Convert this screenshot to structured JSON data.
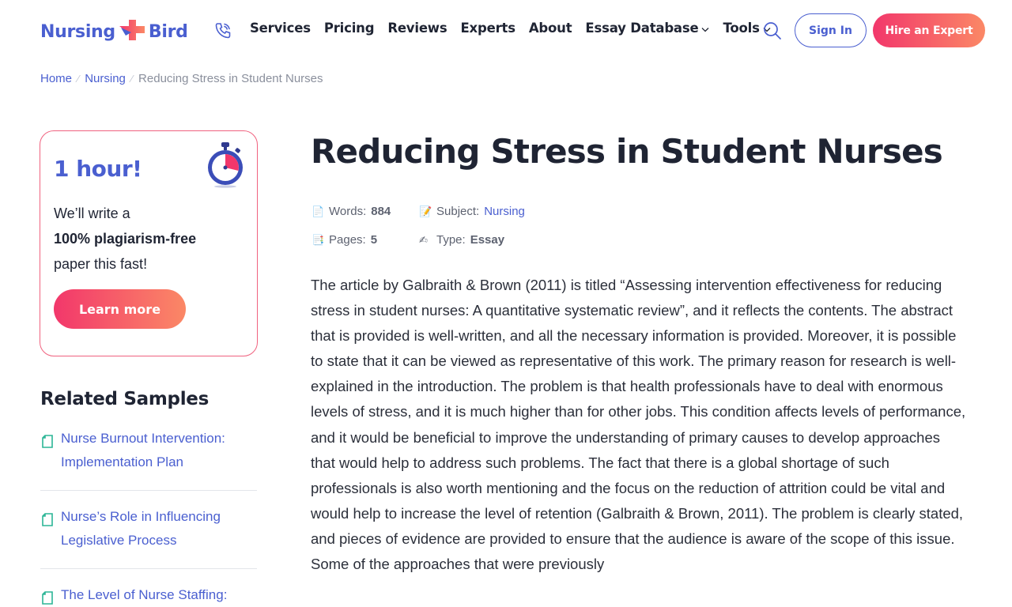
{
  "header": {
    "logo_left": "Nursing",
    "logo_right": "Bird",
    "nav": [
      {
        "label": "Services",
        "dropdown": false
      },
      {
        "label": "Pricing",
        "dropdown": false
      },
      {
        "label": "Reviews",
        "dropdown": false
      },
      {
        "label": "Experts",
        "dropdown": false
      },
      {
        "label": "About",
        "dropdown": false
      },
      {
        "label": "Essay Database",
        "dropdown": true
      },
      {
        "label": "Tools",
        "dropdown": true
      }
    ],
    "signin_label": "Sign In",
    "hire_label": "Hire an Expert"
  },
  "breadcrumb": {
    "home": "Home",
    "category": "Nursing",
    "current": "Reducing Stress in Student Nurses"
  },
  "promo": {
    "title": "1 hour!",
    "line1": "We’ll write a",
    "line2": "100% plagiarism-free",
    "line3": "paper this fast!",
    "button": "Learn more"
  },
  "related": {
    "title": "Related Samples",
    "items": [
      "Nurse Burnout Intervention: Implementation Plan",
      "Nurse’s Role in Influencing Legislative Process",
      "The Level of Nurse Staffing:"
    ]
  },
  "article": {
    "title": "Reducing Stress in Student Nurses",
    "meta": {
      "words_label": "Words:",
      "words": "884",
      "subject_label": "Subject:",
      "subject": "Nursing",
      "pages_label": "Pages:",
      "pages": "5",
      "type_label": "Type:",
      "type": "Essay"
    },
    "body": "The article by Galbraith & Brown (2011) is titled “Assessing intervention effectiveness for reducing stress in student nurses: A quantitative systematic review”, and it reflects the contents. The abstract that is provided is well-written, and all the necessary information is provided. Moreover, it is possible to state that it can be viewed as representative of this work. The primary reason for research is well-explained in the introduction. The problem is that health professionals have to deal with enormous levels of stress, and it is much higher than for other jobs. This condition affects levels of performance, and it would be beneficial to improve the understanding of primary causes to develop approaches that would help to address such problems. The fact that there is a global shortage of such professionals is also worth mentioning and the focus on the reduction of attrition could be vital and would help to increase the level of retention (Galbraith & Brown, 2011). The problem is clearly stated, and pieces of evidence are provided to ensure that the audience is aware of the scope of this issue. Some of the approaches that were previously"
  },
  "colors": {
    "brand_blue": "#4a5fd0",
    "accent_pink": "#f2376b",
    "accent_orange": "#fb8866",
    "text_dark": "#1f2433"
  }
}
